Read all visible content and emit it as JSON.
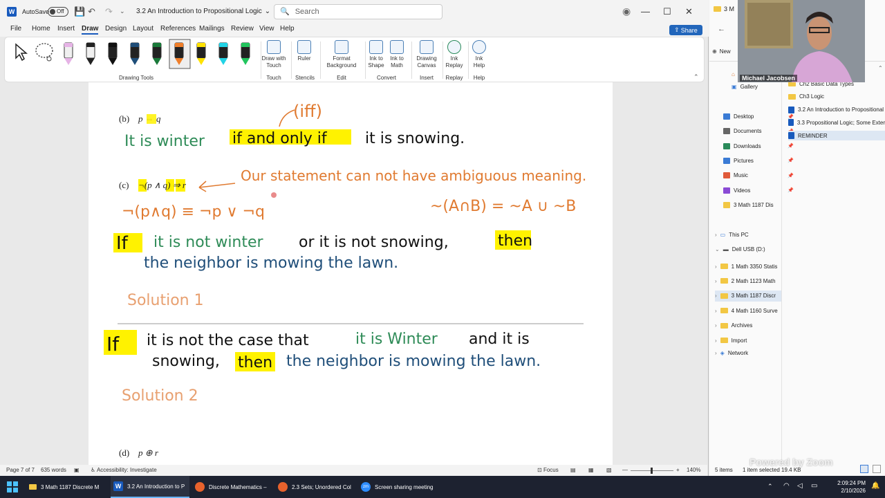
{
  "word": {
    "titlebar": {
      "autosave_label": "AutoSave",
      "autosave_state": "Off",
      "doc_title": "3.2 An Introduction to Propositional Logic",
      "search_placeholder": "Search"
    },
    "menu": [
      "File",
      "Home",
      "Insert",
      "Draw",
      "Design",
      "Layout",
      "References",
      "Mailings",
      "Review",
      "View",
      "Help"
    ],
    "active_menu": "Draw",
    "share_label": "Share",
    "ribbon": {
      "drawing_tools_label": "Drawing Tools",
      "buttons": [
        {
          "label": "Draw with Touch",
          "group": "Touch"
        },
        {
          "label": "Ruler",
          "group": "Stencils"
        },
        {
          "label": "Format Background",
          "group": "Edit"
        },
        {
          "label": "Ink to Shape",
          "group": "Convert"
        },
        {
          "label": "Ink to Math",
          "group": "Convert"
        },
        {
          "label": "Drawing Canvas",
          "group": "Insert"
        },
        {
          "label": "Ink Replay",
          "group": "Replay"
        },
        {
          "label": "Ink Help",
          "group": "Help"
        }
      ],
      "groups": [
        "Touch",
        "Stencils",
        "Edit",
        "Convert",
        "Insert",
        "Replay",
        "Help"
      ],
      "pen_colors": [
        "#e6b3e6",
        "#222222",
        "#111111",
        "#1f4e79",
        "#1a7a3a",
        "#f07f2a",
        "#ffe200",
        "#22d3e6",
        "#22c55e"
      ]
    },
    "doc": {
      "b_label": "(b)",
      "b_expr": "p ⇔ q",
      "b_iff_note": "(iff)",
      "b_sentence_1": "It is winter",
      "b_sentence_2": "if and only if",
      "b_sentence_3": "it is snowing.",
      "c_label": "(c)",
      "c_expr": "¬(p ∧ q) ⇒ r",
      "c_note": "Our statement can not have ambiguous meaning.",
      "c_demorgan": "¬(p∧q) ≡ ¬p ∨ ¬q",
      "c_sets": "~(A∩B) = ~A ∪ ~B",
      "sol1_if": "If",
      "sol1_part1": "it is not winter",
      "sol1_part2": "or it is not snowing,",
      "sol1_then": "then",
      "sol1_part3": "the neighbor is mowing the lawn.",
      "sol1_label": "Solution 1",
      "sol2_if": "If",
      "sol2_part1": "it is not the case that",
      "sol2_part2": "it is Winter",
      "sol2_part3": "and it is",
      "sol2_part4": "snowing,",
      "sol2_then": "then",
      "sol2_part5": "the neighbor is mowing the lawn.",
      "sol2_label": "Solution 2",
      "d_label": "(d)",
      "d_expr": "p ⊕ r"
    },
    "status": {
      "page": "Page 7 of 7",
      "words": "635 words",
      "accessibility": "Accessibility: Investigate",
      "focus": "Focus",
      "zoom": "140%"
    }
  },
  "explorer": {
    "tab_title": "3 M",
    "new_label": "New",
    "gallery": "Gallery",
    "files": [
      "Ch2 Basic Data Types",
      "Ch3 Logic",
      "3.2 An Introduction to Propositional",
      "3.3 Propositional Logic; Some Exter",
      "REMINDER"
    ],
    "quick_access": [
      "Desktop",
      "Documents",
      "Downloads",
      "Pictures",
      "Music",
      "Videos",
      "3 Math 1187 Dis"
    ],
    "this_pc": "This PC",
    "drive": "Dell USB (D:)",
    "drive_folders": [
      "1 Math 3350 Statis",
      "2 Math 1123 Math",
      "3 Math 1187 Discr",
      "4 Math 1160 Surve",
      "Archives",
      "Import"
    ],
    "network": "Network",
    "status_items": "5 items",
    "status_selected": "1 item selected  19.4 KB",
    "webcam_name": "Michael Jacobsen",
    "watermark": "Powered by Zoom"
  },
  "taskbar": {
    "apps": [
      "3 Math 1187 Discrete M",
      "3.2 An Introduction to P",
      "Discrete Mathematics –",
      "2.3 Sets; Unordered Col",
      "Screen sharing meeting"
    ],
    "time": "2:09:24 PM",
    "date": "2/10/2026"
  },
  "colors": {
    "highlight": "#fff200",
    "green_ink": "#2e8b57",
    "blue_ink": "#1f4e79",
    "orange_ink": "#e07a30",
    "black_ink": "#111111",
    "word_blue": "#185abd"
  }
}
